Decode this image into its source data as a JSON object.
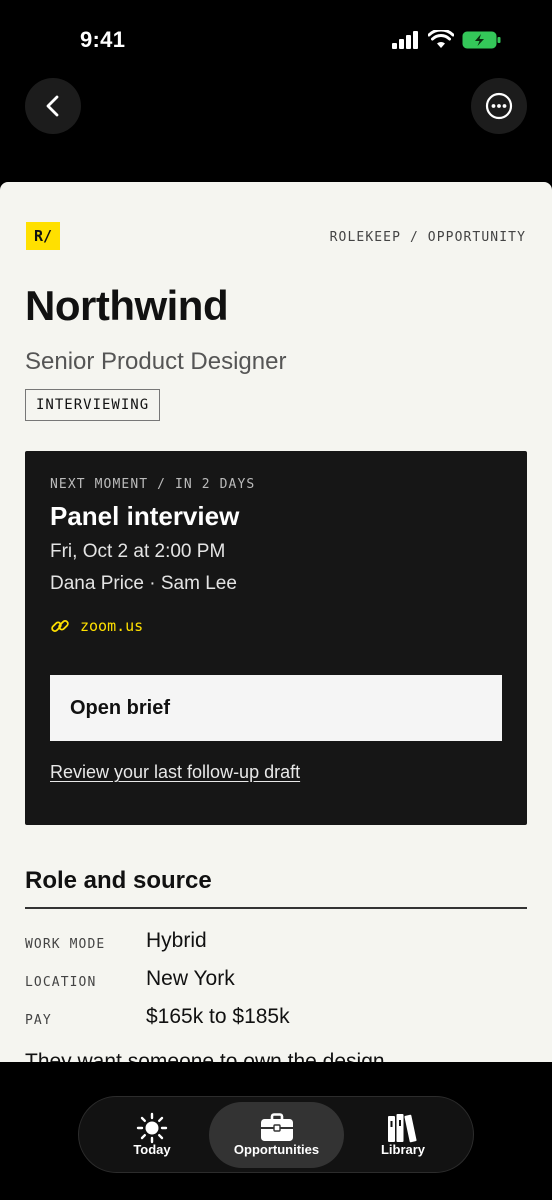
{
  "status": {
    "time": "9:41"
  },
  "brand": {
    "logo": "R/",
    "breadcrumb": "ROLEKEEP / OPPORTUNITY",
    "accent": "#FFE000"
  },
  "opportunity": {
    "company": "Northwind",
    "role": "Senior Product Designer",
    "status": "INTERVIEWING"
  },
  "next_moment": {
    "label": "NEXT MOMENT / IN 2 DAYS",
    "title": "Panel interview",
    "when": "Fri, Oct 2 at 2:00 PM",
    "who": "Dana Price · Sam Lee",
    "link_icon": "link-icon",
    "link": "zoom.us",
    "open_brief": "Open brief",
    "review_link": "Review your last follow-up draft"
  },
  "role_source": {
    "title": "Role and source",
    "rows": [
      {
        "key": "WORK MODE",
        "value": "Hybrid"
      },
      {
        "key": "LOCATION",
        "value": "New York"
      },
      {
        "key": "PAY",
        "value": "$165k to $185k"
      }
    ],
    "description_clipped": "They want someone to own the design"
  },
  "tabs": [
    {
      "label": "Today",
      "icon": "sun-icon",
      "active": false
    },
    {
      "label": "Opportunities",
      "icon": "briefcase-icon",
      "active": true
    },
    {
      "label": "Library",
      "icon": "books-icon",
      "active": false
    }
  ]
}
